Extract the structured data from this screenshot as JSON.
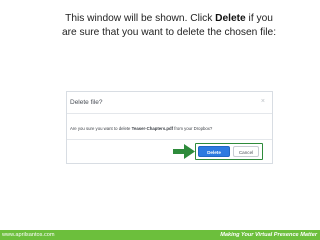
{
  "instruction": {
    "part1": "This window will be shown. Click ",
    "bold": "Delete",
    "part2": " if you are sure that you want to delete the chosen file:"
  },
  "dialog": {
    "title": "Delete file?",
    "close_icon": "×",
    "message_prefix": "Are you sure you want to delete ",
    "file_name": "Teaser-Chapters.pdf",
    "message_suffix": " from your Dropbox?",
    "delete_label": "Delete",
    "cancel_label": "Cancel"
  },
  "footer": {
    "website": "www.aprilsantos.com",
    "tagline": "Making Your Virtual Presence Matter"
  },
  "colors": {
    "footer_bar": "#6cbf3c",
    "highlight": "#2e8b3b",
    "primary_button": "#2d7ae0"
  },
  "icons": {
    "pointer": "arrow-right-icon",
    "close": "close-icon"
  }
}
